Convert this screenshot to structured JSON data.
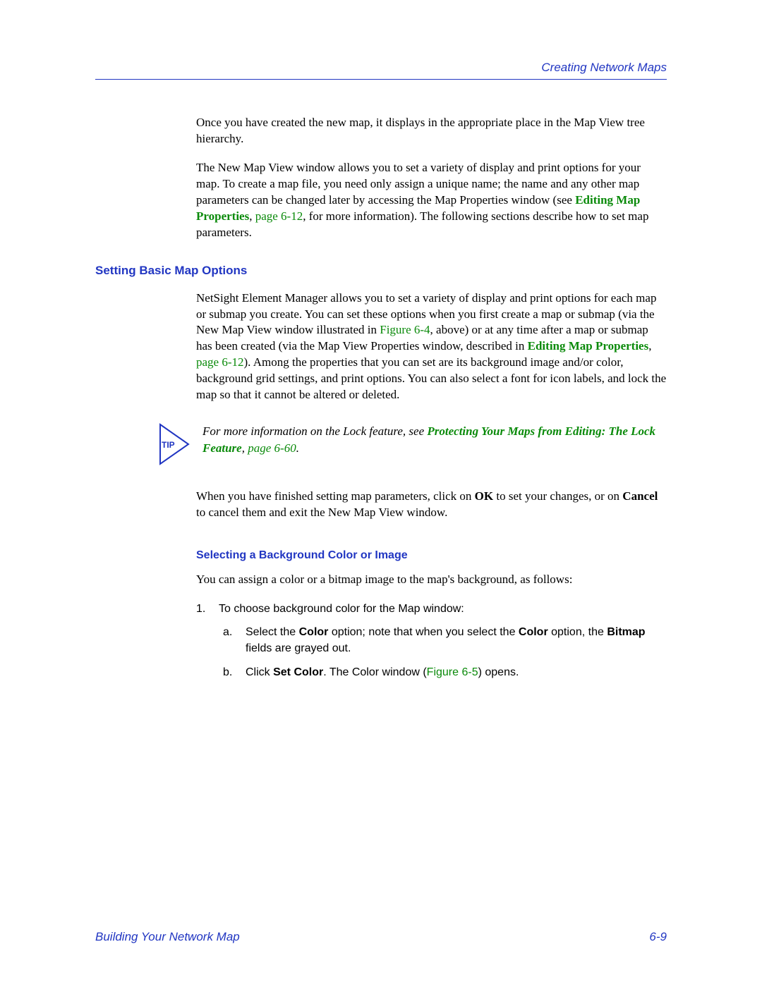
{
  "header": {
    "section": "Creating Network Maps"
  },
  "intro": {
    "p1": "Once you have created the new map, it displays in the appropriate place in the Map View tree hierarchy.",
    "p2a": "The New Map View window allows you to set a variety of display and print options for your map. To create a map file, you need only assign a unique name; the name and any other map parameters can be changed later by accessing the Map Properties window (see ",
    "p2_link": "Editing Map Properties",
    "p2b": ", ",
    "p2_page": "page 6-12",
    "p2c": ", for more information). The following sections describe how to set map parameters."
  },
  "section1": {
    "title": "Setting Basic Map Options",
    "p1a": "NetSight Element Manager allows you to set a variety of display and print options for each map or submap you create. You can set these options when you first create a map or submap (via the New Map View window illustrated in ",
    "p1_fig": "Figure 6-4",
    "p1b": ", above) or at any time after a map or submap has been created (via the Map View Properties window, described in ",
    "p1_link": "Editing Map Properties",
    "p1c": ", ",
    "p1_page": "page 6-12",
    "p1d": "). Among the properties that you can set are its background image and/or color, background grid settings, and print options. You can also select a font for icon labels, and lock the map so that it cannot be altered or deleted."
  },
  "tip": {
    "label": "TIP",
    "a": "For more information on the Lock feature, see ",
    "link": "Protecting Your Maps from Editing: The Lock Feature",
    "b": ", ",
    "page": "page 6-60",
    "c": "."
  },
  "after_tip": {
    "a": "When you have finished setting map parameters, click on ",
    "ok": "OK",
    "b": " to set your changes, or on ",
    "cancel": "Cancel",
    "c": " to cancel them and exit the New Map View window."
  },
  "section2": {
    "title": "Selecting a Background Color or Image",
    "lead": "You can assign a color or a bitmap image to the map's background, as follows:",
    "step1": {
      "num": "1.",
      "text": "To choose background color for the Map window:",
      "a": {
        "num": "a.",
        "t1": "Select the ",
        "b1": "Color",
        "t2": " option; note that when you select the ",
        "b2": "Color",
        "t3": " option, the ",
        "b3": "Bitmap",
        "t4": " fields are grayed out."
      },
      "b": {
        "num": "b.",
        "t1": "Click ",
        "b1": "Set Color",
        "t2": ". The Color window (",
        "fig": "Figure 6-5",
        "t3": ") opens."
      }
    }
  },
  "footer": {
    "left": "Building Your Network Map",
    "right": "6-9"
  }
}
